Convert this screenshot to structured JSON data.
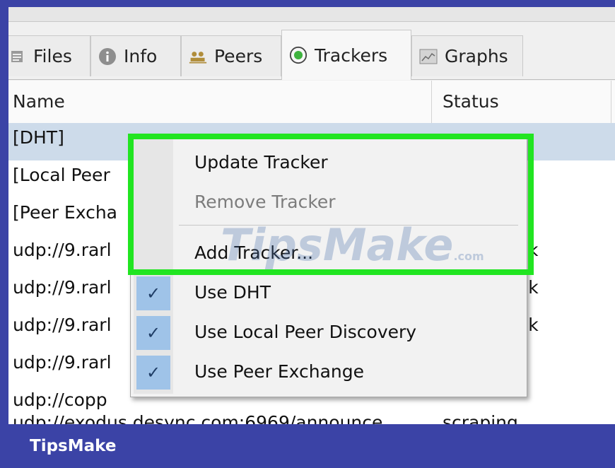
{
  "tabs": [
    {
      "label": "Files",
      "icon": "files-icon"
    },
    {
      "label": "Info",
      "icon": "info-icon"
    },
    {
      "label": "Peers",
      "icon": "peers-icon"
    },
    {
      "label": "Trackers",
      "icon": "trackers-icon",
      "active": true
    },
    {
      "label": "Graphs",
      "icon": "graphs-icon"
    }
  ],
  "table": {
    "headers": [
      "Name",
      "Status"
    ],
    "rows": [
      {
        "name": "[DHT]",
        "status": "",
        "selected": true
      },
      {
        "name": "[Local Peer",
        "status": ""
      },
      {
        "name": "[Peer Excha",
        "status": ""
      },
      {
        "name": "udp://9.rarl",
        "status": "k"
      },
      {
        "name": "udp://9.rarl",
        "status": "ok"
      },
      {
        "name": "udp://9.rarl",
        "status": "ok"
      },
      {
        "name": "udp://9.rarl",
        "status": ""
      },
      {
        "name": "udp://copp",
        "status": ""
      },
      {
        "name": "udp://exodus.desync.com:6969/announce",
        "status": "scraping"
      }
    ]
  },
  "context_menu": {
    "update_tracker": "Update Tracker",
    "remove_tracker": "Remove Tracker",
    "add_tracker": "Add Tracker...",
    "use_dht": "Use DHT",
    "use_local_peer_discovery": "Use Local Peer Discovery",
    "use_peer_exchange": "Use Peer Exchange",
    "check_glyph": "✓"
  },
  "watermark": {
    "text": "TipsMake",
    "domain": ".com"
  },
  "footer": {
    "brand": "TipsMake"
  },
  "colors": {
    "highlight": "#21e521",
    "brand_bar": "#3b43a6",
    "selection": "#cddbea",
    "check_gutter": "#9fc3e8"
  }
}
